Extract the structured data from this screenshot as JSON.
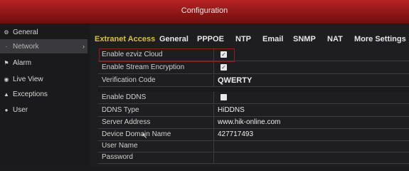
{
  "window": {
    "title": "Configuration"
  },
  "sidebar": {
    "items": [
      {
        "label": "General",
        "icon": "gear-icon",
        "glyph": "⚙"
      },
      {
        "label": "Network",
        "icon": "network-icon",
        "glyph": "·",
        "active": true
      },
      {
        "label": "Alarm",
        "icon": "alarm-icon",
        "glyph": "⚑"
      },
      {
        "label": "Live View",
        "icon": "eye-icon",
        "glyph": "◉"
      },
      {
        "label": "Exceptions",
        "icon": "warning-icon",
        "glyph": "▲"
      },
      {
        "label": "User",
        "icon": "user-icon",
        "glyph": "●"
      }
    ]
  },
  "tabs": [
    {
      "label": "Extranet Access",
      "active": true
    },
    {
      "label": "General"
    },
    {
      "label": "PPPOE"
    },
    {
      "label": "NTP"
    },
    {
      "label": "Email"
    },
    {
      "label": "SNMP"
    },
    {
      "label": "NAT"
    },
    {
      "label": "More Settings"
    }
  ],
  "form": {
    "enable_ezviz": {
      "label": "Enable ezviz Cloud",
      "checked": true
    },
    "enable_encryption": {
      "label": "Enable Stream Encryption",
      "checked": true
    },
    "verification_code": {
      "label": "Verification Code",
      "value": "QWERTY"
    },
    "enable_ddns": {
      "label": "Enable DDNS",
      "checked": false
    },
    "ddns_type": {
      "label": "DDNS Type",
      "value": "HiDDNS"
    },
    "server_address": {
      "label": "Server Address",
      "value": "www.hik-online.com"
    },
    "device_domain": {
      "label": "Device Domain Name",
      "value": "427717493"
    },
    "user_name": {
      "label": "User Name",
      "value": ""
    },
    "password": {
      "label": "Password",
      "value": ""
    }
  },
  "colors": {
    "title_bar": "#a81d1d",
    "active_tab": "#d9c13a",
    "highlight_border": "#8c2020"
  }
}
